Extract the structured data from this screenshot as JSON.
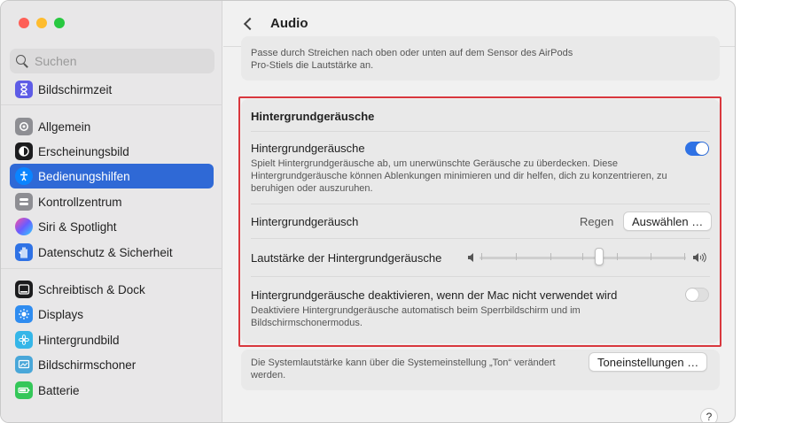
{
  "window": {
    "title": "Audio"
  },
  "search": {
    "placeholder": "Suchen"
  },
  "sidebar": {
    "items": [
      {
        "label": "Bildschirmzeit",
        "icon": "hourglass-icon",
        "color": "#5e5ce6"
      },
      {
        "label": "Allgemein",
        "icon": "gear-icon",
        "color": "#8e8e93"
      },
      {
        "label": "Erscheinungsbild",
        "icon": "appearance-icon",
        "color": "#1c1c1e"
      },
      {
        "label": "Bedienungshilfen",
        "icon": "accessibility-icon",
        "color": "#0a84ff"
      },
      {
        "label": "Kontrollzentrum",
        "icon": "control-center-icon",
        "color": "#8e8e93"
      },
      {
        "label": "Siri & Spotlight",
        "icon": "siri-icon",
        "color": "#6a5cff"
      },
      {
        "label": "Datenschutz & Sicherheit",
        "icon": "hand-icon",
        "color": "#2f72e5"
      },
      {
        "label": "Schreibtisch & Dock",
        "icon": "dock-icon",
        "color": "#1c1c1e"
      },
      {
        "label": "Displays",
        "icon": "displays-icon",
        "color": "#2f8cf0"
      },
      {
        "label": "Hintergrundbild",
        "icon": "wallpaper-icon",
        "color": "#35b6e8"
      },
      {
        "label": "Bildschirmschoner",
        "icon": "screensaver-icon",
        "color": "#49a7d9"
      },
      {
        "label": "Batterie",
        "icon": "battery-icon",
        "color": "#34c759"
      }
    ]
  },
  "content": {
    "top_note": "Passe durch Streichen nach oben oder unten auf dem Sensor des AirPods Pro-Stiels die Lautstärke an.",
    "section_title": "Hintergrundgeräusche",
    "bg_sounds": {
      "title": "Hintergrundgeräusche",
      "description": "Spielt Hintergrundgeräusche ab, um unerwünschte Geräusche zu überdecken. Diese Hintergrundgeräusche können Ablenkungen minimieren und dir helfen, dich zu konzentrieren, zu beruhigen oder auszuruhen.",
      "enabled": true
    },
    "bg_sound": {
      "title": "Hintergrundgeräusch",
      "value": "Regen",
      "button": "Auswählen …"
    },
    "volume": {
      "title": "Lautstärke der Hintergrundgeräusche",
      "level": 0.58
    },
    "deactivate": {
      "title": "Hintergrundgeräusche deaktivieren, wenn der Mac nicht verwendet wird",
      "description": "Deaktiviere Hintergrundgeräusche automatisch beim Sperrbildschirm und im Bildschirmschonermodus.",
      "enabled": false
    },
    "footer": {
      "text": "Die Systemlautstärke kann über die Systemeinstellung „Ton“ verändert werden.",
      "button": "Toneinstellungen …"
    },
    "help": "?"
  },
  "colors": {
    "accent": "#2f69d6",
    "highlight": "#d9383e"
  }
}
